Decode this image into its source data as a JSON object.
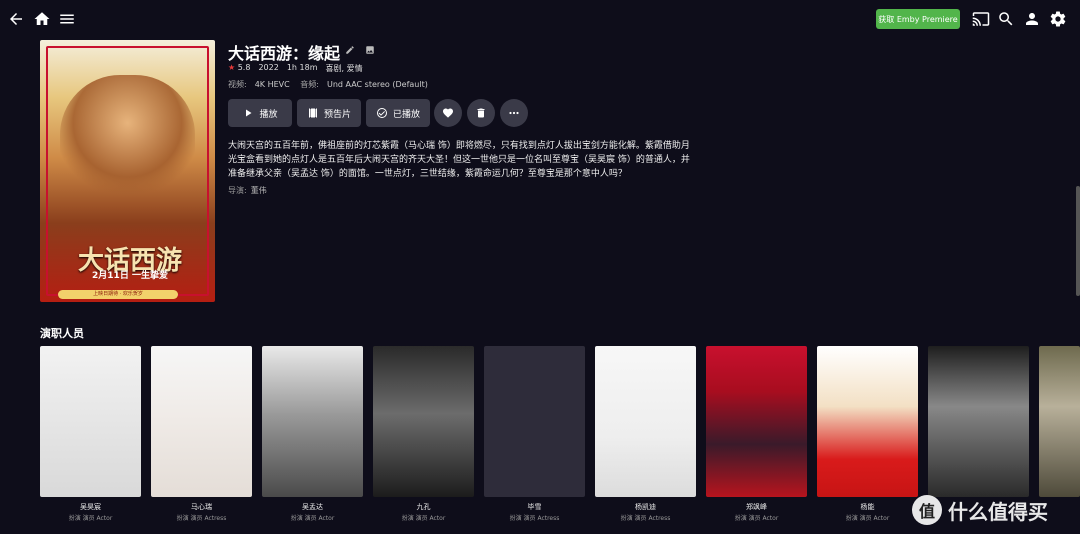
{
  "header": {
    "premiere_label": "获取 Emby Premiere",
    "colors": {
      "premiere_bg": "#52b54b"
    }
  },
  "movie": {
    "poster": {
      "title_text": "大话西游",
      "date_text": "2月11日 一生挚爱",
      "bar_text": "上映日期待 · 欢乐贺岁"
    },
    "title": "大话西游：缘起",
    "rating": "5.8",
    "year": "2022",
    "runtime": "1h 18m",
    "genres": "喜剧, 爱情",
    "video_label": "视频:",
    "video_value": "4K HEVC",
    "audio_label": "音频:",
    "audio_value": "Und AAC stereo (Default)",
    "overview": "大闹天宫的五百年前，佛祖座前的灯芯紫霞（马心瑞 饰）即将燃尽，只有找到点灯人拔出宝剑方能化解。紫霞借助月光宝盒看到她的点灯人是五百年后大闹天宫的齐天大圣！但这一世他只是一位名叫至尊宝（吴昊宸 饰）的普通人，并准备继承父亲（吴孟达 饰）的面馆。一世点灯，三世结缘，紫霞命运几何？至尊宝是那个意中人吗？",
    "director_label": "导演:",
    "director": "董伟"
  },
  "actions": {
    "play": "播放",
    "trailer": "预告片",
    "played": "已播放"
  },
  "cast": {
    "section_title": "演职人员",
    "people": [
      {
        "name": "吴昊宸",
        "role": "扮演 演员 Actor"
      },
      {
        "name": "马心瑞",
        "role": "扮演 演员 Actress"
      },
      {
        "name": "吴孟达",
        "role": "扮演 演员 Actor"
      },
      {
        "name": "九孔",
        "role": "扮演 演员 Actor"
      },
      {
        "name": "毕雪",
        "role": "扮演 演员 Actress"
      },
      {
        "name": "杨凯迪",
        "role": "扮演 演员 Actress"
      },
      {
        "name": "郑飒峰",
        "role": "扮演 演员 Actor"
      },
      {
        "name": "杨能",
        "role": "扮演 演员 Actor"
      },
      {
        "name": "",
        "role": ""
      },
      {
        "name": "",
        "role": ""
      }
    ]
  },
  "watermark": {
    "badge": "值",
    "text": "什么值得买"
  }
}
